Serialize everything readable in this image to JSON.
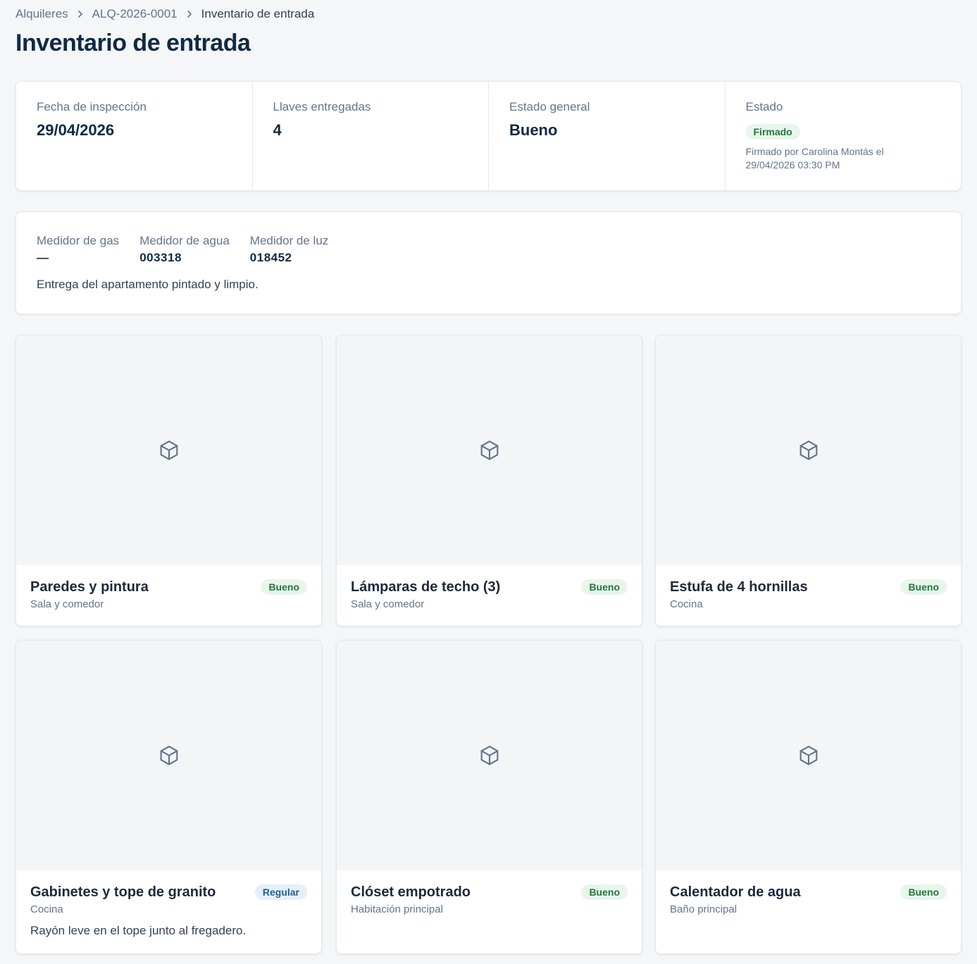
{
  "breadcrumb": {
    "items": [
      "Alquileres",
      "ALQ-2026-0001"
    ],
    "current": "Inventario de entrada"
  },
  "page": {
    "title": "Inventario de entrada"
  },
  "summary": {
    "inspection_date": {
      "label": "Fecha de inspección",
      "value": "29/04/2026"
    },
    "keys": {
      "label": "Llaves entregadas",
      "value": "4"
    },
    "general_state": {
      "label": "Estado general",
      "value": "Bueno"
    },
    "status": {
      "label": "Estado",
      "badge": "Firmado",
      "signed_text": "Firmado por Carolina Montás el 29/04/2026 03:30 PM"
    }
  },
  "meters": {
    "gas": {
      "label": "Medidor de gas",
      "value": "—"
    },
    "water": {
      "label": "Medidor de agua",
      "value": "003318"
    },
    "power": {
      "label": "Medidor de luz",
      "value": "018452"
    },
    "note": "Entrega del apartamento pintado y limpio."
  },
  "items": [
    {
      "name": "Paredes y pintura",
      "location": "Sala y comedor",
      "condition": "Bueno",
      "note": ""
    },
    {
      "name": "Lámparas de techo (3)",
      "location": "Sala y comedor",
      "condition": "Bueno",
      "note": ""
    },
    {
      "name": "Estufa de 4 hornillas",
      "location": "Cocina",
      "condition": "Bueno",
      "note": ""
    },
    {
      "name": "Gabinetes y tope de granito",
      "location": "Cocina",
      "condition": "Regular",
      "note": "Rayón leve en el tope junto al fregadero."
    },
    {
      "name": "Clóset empotrado",
      "location": "Habitación principal",
      "condition": "Bueno",
      "note": ""
    },
    {
      "name": "Calentador de agua",
      "location": "Baño principal",
      "condition": "Bueno",
      "note": ""
    }
  ],
  "colors": {
    "good_badge_bg": "#e8f5ec",
    "good_badge_text": "#1f7a3a",
    "regular_badge_bg": "#e6f0fa",
    "regular_badge_text": "#1f5f96",
    "title": "#0f2a44"
  },
  "icons": {
    "item_placeholder": "package-icon",
    "breadcrumb_separator": "chevron-right-icon"
  }
}
